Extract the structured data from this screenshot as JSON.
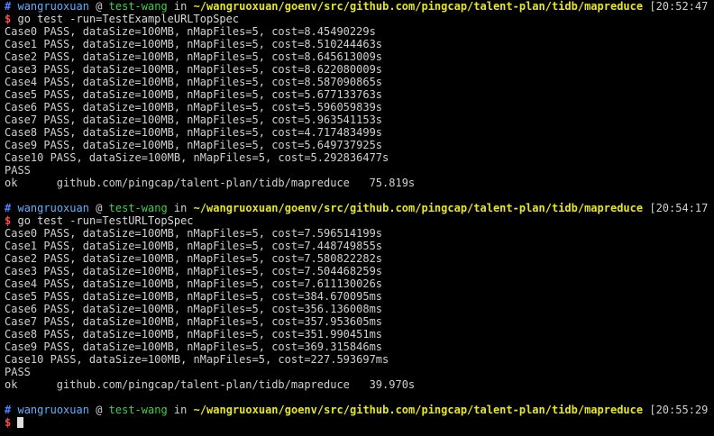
{
  "colors": {
    "background": "#000000",
    "hash": "#4f7fff",
    "user": "#5fb0ff",
    "host": "#3fd04b",
    "path": "#e5e52a",
    "prompt": "#ff4b4b",
    "text": "#d0d0d0"
  },
  "blocks": [
    {
      "header": {
        "hash": "#",
        "user": "wangruoxuan",
        "at": "@",
        "host": "test-wang",
        "in": "in",
        "path": "~/wangruoxuan/goenv/src/github.com/pingcap/talent-plan/tidb/mapreduce",
        "time": "[20:52:47]"
      },
      "prompt": "$",
      "command": "go test -run=TestExampleURLTopSpec",
      "output": [
        "Case0 PASS, dataSize=100MB, nMapFiles=5, cost=8.45490229s",
        "Case1 PASS, dataSize=100MB, nMapFiles=5, cost=8.510244463s",
        "Case2 PASS, dataSize=100MB, nMapFiles=5, cost=8.645613009s",
        "Case3 PASS, dataSize=100MB, nMapFiles=5, cost=8.622080009s",
        "Case4 PASS, dataSize=100MB, nMapFiles=5, cost=8.587090865s",
        "Case5 PASS, dataSize=100MB, nMapFiles=5, cost=5.677133763s",
        "Case6 PASS, dataSize=100MB, nMapFiles=5, cost=5.596059839s",
        "Case7 PASS, dataSize=100MB, nMapFiles=5, cost=5.963541153s",
        "Case8 PASS, dataSize=100MB, nMapFiles=5, cost=4.717483499s",
        "Case9 PASS, dataSize=100MB, nMapFiles=5, cost=5.649737925s",
        "Case10 PASS, dataSize=100MB, nMapFiles=5, cost=5.292836477s",
        "PASS",
        "ok      github.com/pingcap/talent-plan/tidb/mapreduce   75.819s"
      ]
    },
    {
      "header": {
        "hash": "#",
        "user": "wangruoxuan",
        "at": "@",
        "host": "test-wang",
        "in": "in",
        "path": "~/wangruoxuan/goenv/src/github.com/pingcap/talent-plan/tidb/mapreduce",
        "time": "[20:54:17]"
      },
      "prompt": "$",
      "command": "go test -run=TestURLTopSpec",
      "output": [
        "Case0 PASS, dataSize=100MB, nMapFiles=5, cost=7.596514199s",
        "Case1 PASS, dataSize=100MB, nMapFiles=5, cost=7.448749855s",
        "Case2 PASS, dataSize=100MB, nMapFiles=5, cost=7.580822282s",
        "Case3 PASS, dataSize=100MB, nMapFiles=5, cost=7.504468259s",
        "Case4 PASS, dataSize=100MB, nMapFiles=5, cost=7.611130026s",
        "Case5 PASS, dataSize=100MB, nMapFiles=5, cost=384.670095ms",
        "Case6 PASS, dataSize=100MB, nMapFiles=5, cost=356.136008ms",
        "Case7 PASS, dataSize=100MB, nMapFiles=5, cost=357.953605ms",
        "Case8 PASS, dataSize=100MB, nMapFiles=5, cost=351.990451ms",
        "Case9 PASS, dataSize=100MB, nMapFiles=5, cost=369.315846ms",
        "Case10 PASS, dataSize=100MB, nMapFiles=5, cost=227.593697ms",
        "PASS",
        "ok      github.com/pingcap/talent-plan/tidb/mapreduce   39.970s"
      ]
    }
  ],
  "final": {
    "header": {
      "hash": "#",
      "user": "wangruoxuan",
      "at": "@",
      "host": "test-wang",
      "in": "in",
      "path": "~/wangruoxuan/goenv/src/github.com/pingcap/talent-plan/tidb/mapreduce",
      "time": "[20:55:29]"
    },
    "prompt": "$"
  }
}
